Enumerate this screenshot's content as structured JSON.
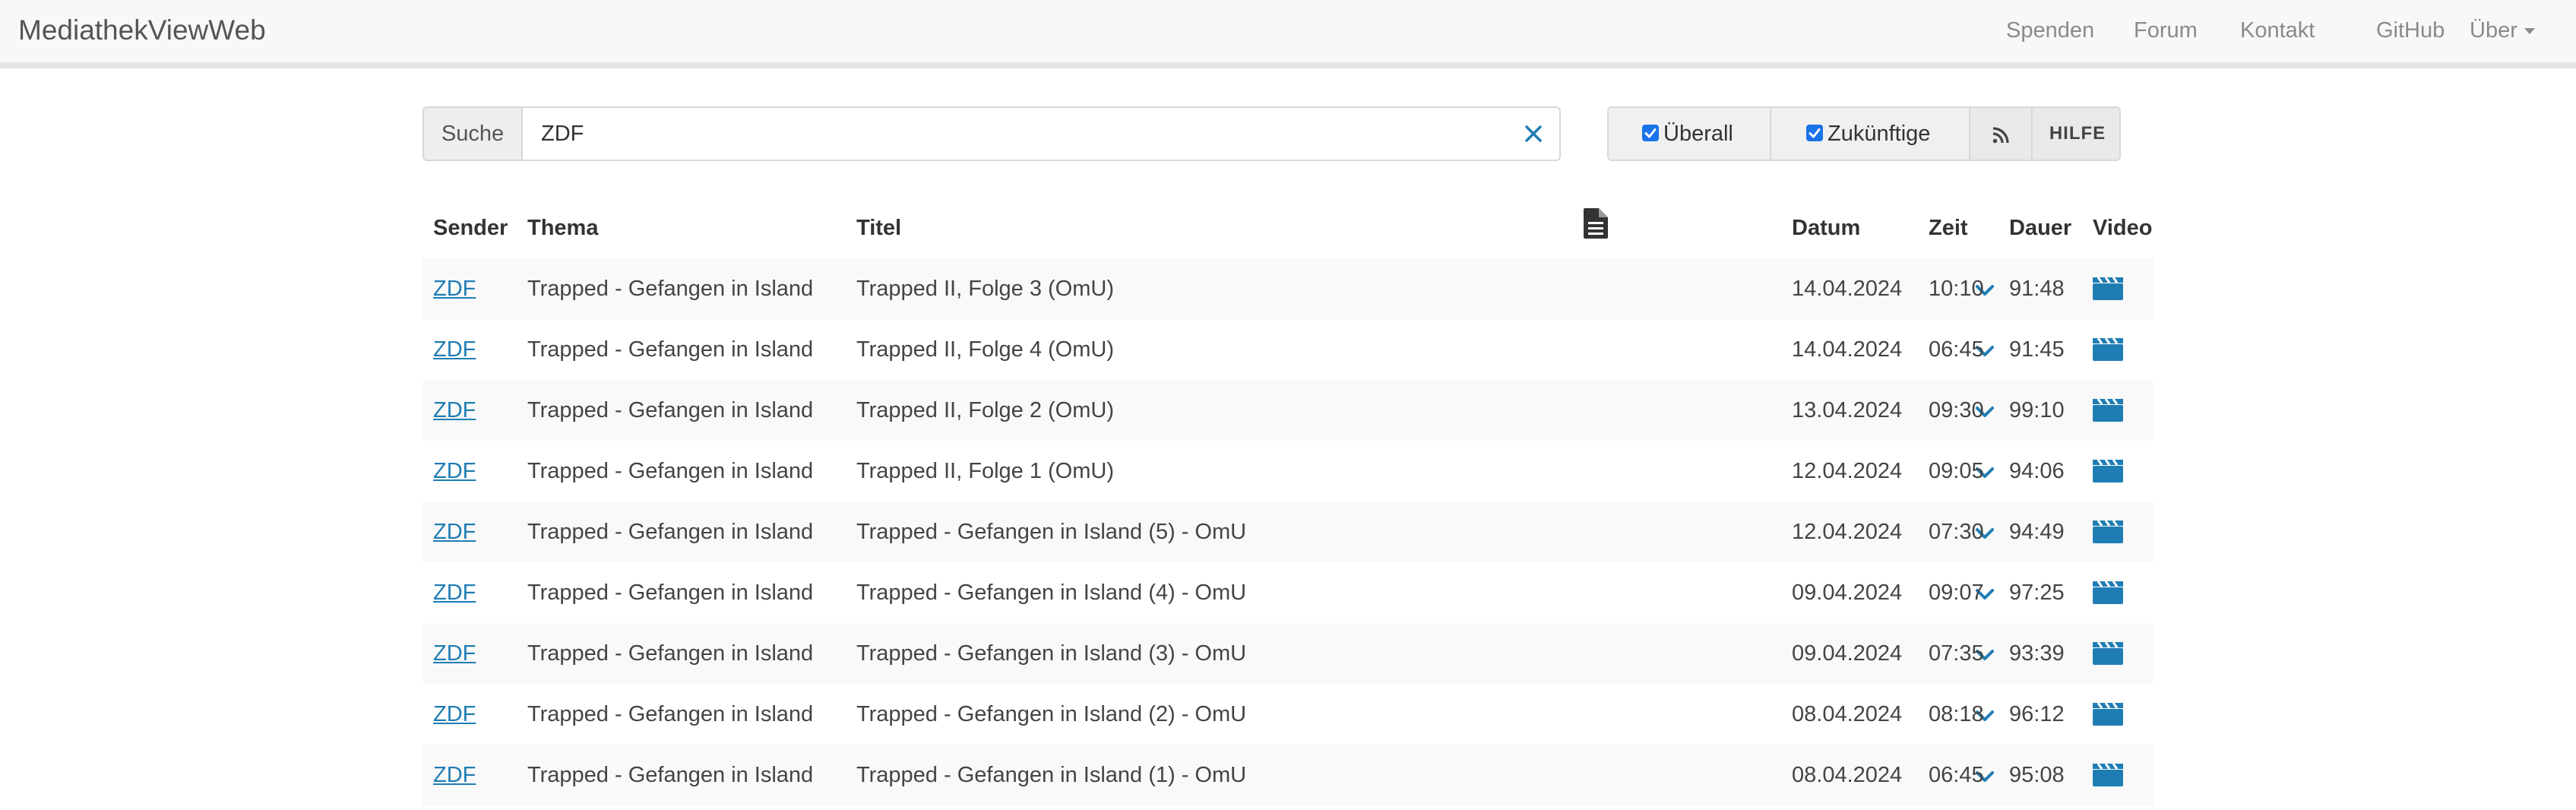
{
  "navbar": {
    "brand": "MediathekViewWeb",
    "items": [
      {
        "label": "Spenden"
      },
      {
        "label": "Forum"
      },
      {
        "label": "Kontakt"
      },
      {
        "label": "GitHub"
      },
      {
        "label": "Über"
      }
    ]
  },
  "search": {
    "addon_label": "Suche",
    "value": "ZDF",
    "clear_icon": "close-icon"
  },
  "options": {
    "everywhere": {
      "label": "Überall",
      "checked": true
    },
    "future": {
      "label": "Zukünftige",
      "checked": true
    },
    "rss_icon": "rss-icon",
    "help_label": "HILFE"
  },
  "colors": {
    "link": "#1f7db3",
    "icon": "#1f7db3",
    "checkbox": "#1a73e8",
    "row_stripe": "#f9f9f9",
    "navbar_bg": "#f8f8f8"
  },
  "table": {
    "headers": {
      "sender": "Sender",
      "thema": "Thema",
      "titel": "Titel",
      "description_icon": "document-icon",
      "datum": "Datum",
      "zeit": "Zeit",
      "dauer": "Dauer",
      "video": "Video"
    },
    "rows": [
      {
        "sender": "ZDF",
        "thema": "Trapped - Gefangen in Island",
        "titel": "Trapped II, Folge 3 (OmU)",
        "datum": "14.04.2024",
        "zeit": "10:10",
        "dauer": "91:48"
      },
      {
        "sender": "ZDF",
        "thema": "Trapped - Gefangen in Island",
        "titel": "Trapped II, Folge 4 (OmU)",
        "datum": "14.04.2024",
        "zeit": "06:45",
        "dauer": "91:45"
      },
      {
        "sender": "ZDF",
        "thema": "Trapped - Gefangen in Island",
        "titel": "Trapped II, Folge 2 (OmU)",
        "datum": "13.04.2024",
        "zeit": "09:30",
        "dauer": "99:10"
      },
      {
        "sender": "ZDF",
        "thema": "Trapped - Gefangen in Island",
        "titel": "Trapped II, Folge 1 (OmU)",
        "datum": "12.04.2024",
        "zeit": "09:05",
        "dauer": "94:06"
      },
      {
        "sender": "ZDF",
        "thema": "Trapped - Gefangen in Island",
        "titel": "Trapped - Gefangen in Island (5) - OmU",
        "datum": "12.04.2024",
        "zeit": "07:30",
        "dauer": "94:49"
      },
      {
        "sender": "ZDF",
        "thema": "Trapped - Gefangen in Island",
        "titel": "Trapped - Gefangen in Island (4) - OmU",
        "datum": "09.04.2024",
        "zeit": "09:07",
        "dauer": "97:25"
      },
      {
        "sender": "ZDF",
        "thema": "Trapped - Gefangen in Island",
        "titel": "Trapped - Gefangen in Island (3) - OmU",
        "datum": "09.04.2024",
        "zeit": "07:35",
        "dauer": "93:39"
      },
      {
        "sender": "ZDF",
        "thema": "Trapped - Gefangen in Island",
        "titel": "Trapped - Gefangen in Island (2) - OmU",
        "datum": "08.04.2024",
        "zeit": "08:18",
        "dauer": "96:12"
      },
      {
        "sender": "ZDF",
        "thema": "Trapped - Gefangen in Island",
        "titel": "Trapped - Gefangen in Island (1) - OmU",
        "datum": "08.04.2024",
        "zeit": "06:45",
        "dauer": "95:08"
      }
    ]
  }
}
